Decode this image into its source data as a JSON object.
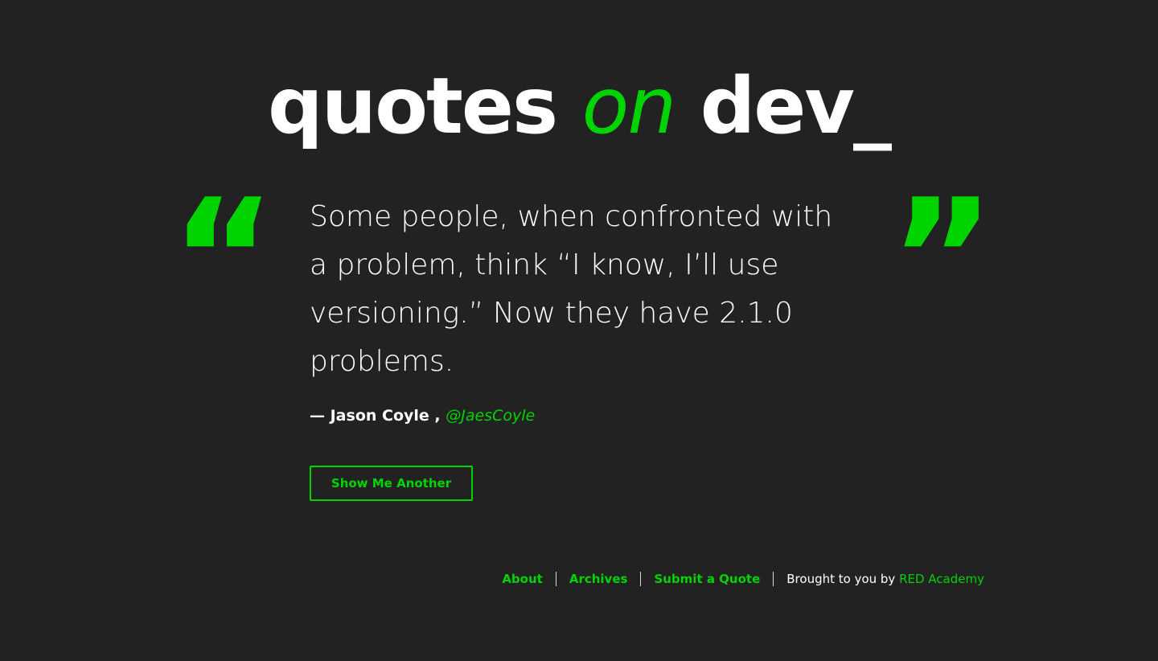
{
  "header": {
    "title_part1": "quotes",
    "title_part2": "on",
    "title_part3": "dev_"
  },
  "quote": {
    "open_mark": "“",
    "close_mark": "”",
    "text": "Some people, when confronted with a problem, think “I know, I’ll use versioning.” Now they have 2.1.0 problems.",
    "author": "— Jason Coyle ,",
    "source": "@JaesCoyle"
  },
  "button": {
    "label": "Show Me Another"
  },
  "footer": {
    "links": [
      "About",
      "Archives",
      "Submit a Quote"
    ],
    "credit_prefix": "Brought to you by",
    "credit_link": "RED Academy"
  },
  "colors": {
    "background": "#222222",
    "accent": "#00d400",
    "text": "#ffffff"
  }
}
